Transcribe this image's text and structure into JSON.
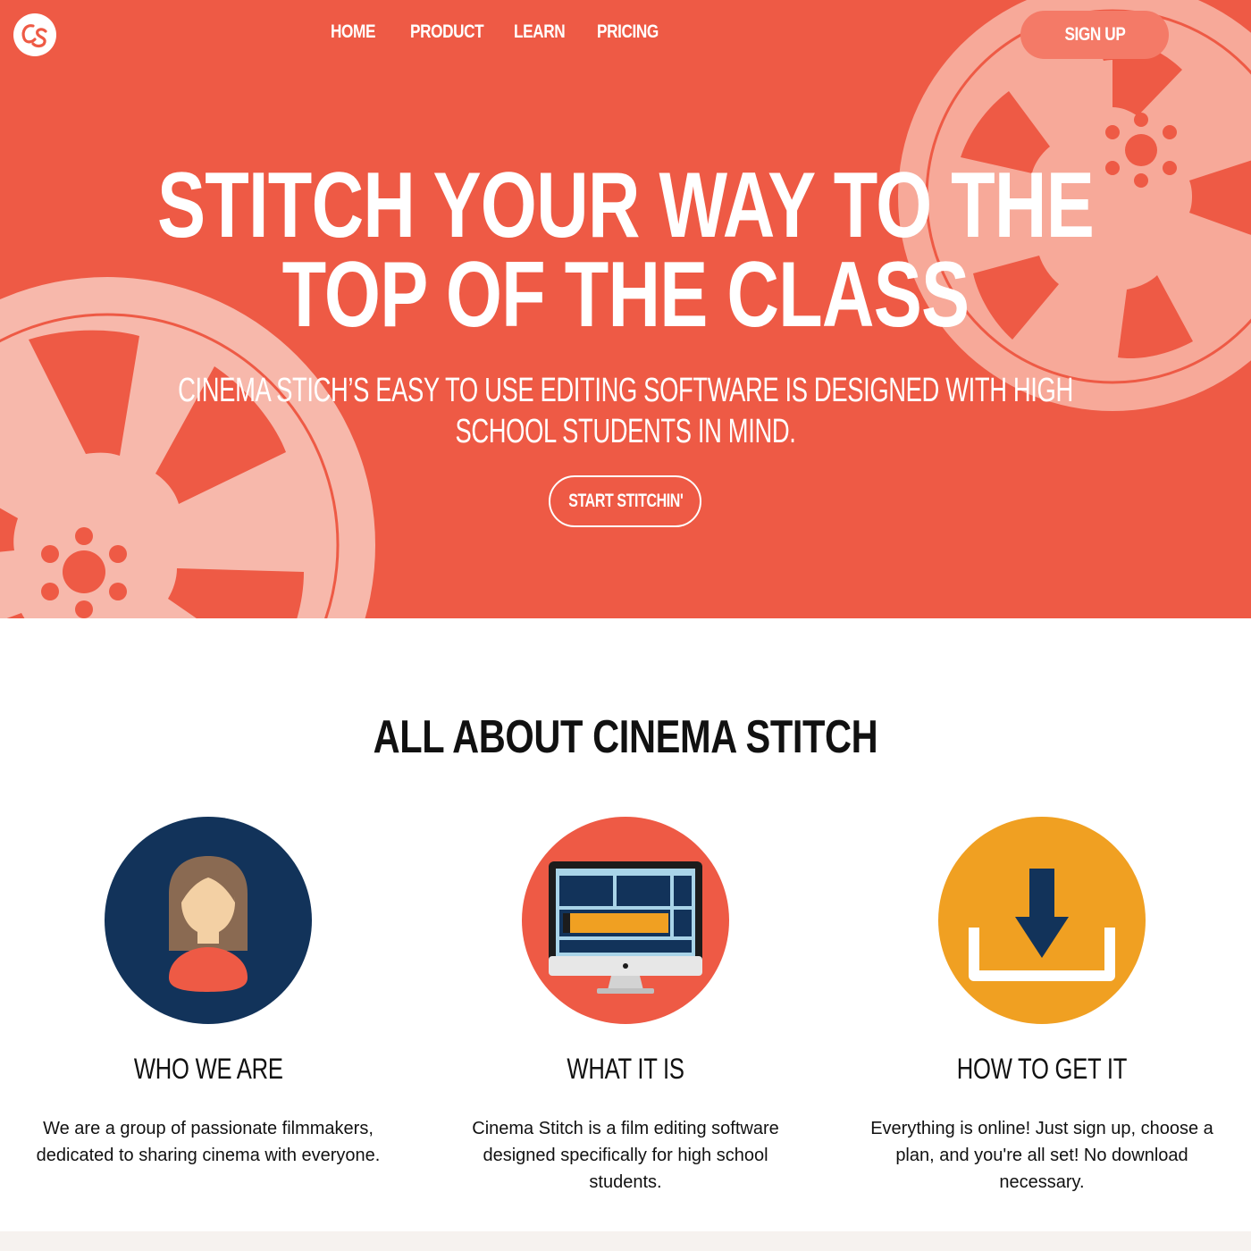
{
  "brand": {
    "logo_text": "CS",
    "accent": "#ee5a45",
    "accent_light": "#f47a67",
    "navy": "#12335a",
    "orange": "#f0a022"
  },
  "nav": {
    "items": [
      {
        "label": "HOME"
      },
      {
        "label": "PRODUCT"
      },
      {
        "label": "LEARN"
      },
      {
        "label": "PRICING"
      }
    ],
    "signup_label": "SIGN UP"
  },
  "hero": {
    "title_line1": "STITCH YOUR WAY TO THE",
    "title_line2": "TOP OF THE CLASS",
    "subtitle_line1": "CINEMA STICH’S EASY TO USE EDITING SOFTWARE IS DESIGNED WITH HIGH",
    "subtitle_line2": "SCHOOL STUDENTS IN MIND.",
    "cta_label": "START STITCHIN'"
  },
  "about": {
    "title": "ALL ABOUT CINEMA STITCH",
    "features": [
      {
        "icon": "person-icon",
        "heading": "WHO WE ARE",
        "text": "We are a group of passionate filmmakers, dedicated to sharing cinema with everyone."
      },
      {
        "icon": "monitor-icon",
        "heading": "WHAT IT IS",
        "text": "Cinema Stitch is a film editing software designed specifically for high school students."
      },
      {
        "icon": "download-icon",
        "heading": "HOW TO GET IT",
        "text": "Everything is online! Just sign up, choose a plan, and you're all set! No download necessary."
      }
    ]
  }
}
